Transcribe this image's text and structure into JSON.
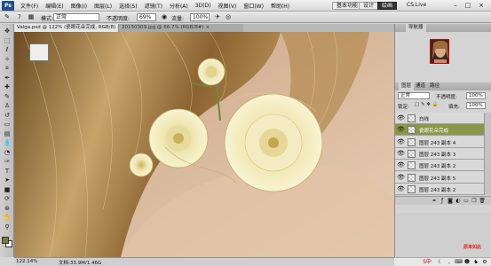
{
  "app": {
    "logo": "Ps",
    "menu": [
      "文件(F)",
      "编辑(E)",
      "图像(I)",
      "图层(L)",
      "选择(S)",
      "滤镜(T)",
      "分析(A)",
      "3D(D)",
      "视图(V)",
      "窗口(W)",
      "帮助(H)"
    ],
    "workspace_buttons": [
      "基本功能",
      "设计",
      "绘画"
    ],
    "active_workspace": "绘画",
    "cs_live": "CS Live",
    "window_controls": [
      "–",
      "□",
      "×"
    ]
  },
  "options": {
    "mode_label": "模式:",
    "mode_value": "正常",
    "opacity_label": "不透明度:",
    "opacity_value": "69%",
    "flow_label": "流量:",
    "flow_value": "100%",
    "brush_size": "7"
  },
  "documents": {
    "tabs": [
      {
        "label": "Valga.psd @ 122% (瓷眼花朵完成, RGB/8) ×",
        "active": true
      },
      {
        "label": "20150309.jpg @ 66.7% (RGB/8#) ×",
        "active": false
      }
    ]
  },
  "status": {
    "zoom": "122.14%",
    "doc_info": "文档:33.9M/1.46G"
  },
  "tools": {
    "icons": [
      "move-icon",
      "marquee-icon",
      "lasso-icon",
      "quick-select-icon",
      "crop-icon",
      "eyedropper-icon",
      "healing-icon",
      "brush-icon",
      "clone-stamp-icon",
      "history-brush-icon",
      "eraser-icon",
      "gradient-icon",
      "blur-icon",
      "dodge-icon",
      "pen-icon",
      "type-icon",
      "path-select-icon",
      "shape-icon",
      "3d-rotate-icon",
      "3d-orbit-icon",
      "hand-icon",
      "zoom-icon"
    ],
    "foreground_color": "#7a7d33",
    "background_color": "#ffffff"
  },
  "navigator": {
    "tab": "导航器"
  },
  "layers": {
    "tabs": [
      "图层",
      "通道",
      "路径"
    ],
    "blend_mode": "正常",
    "opacity_label": "不透明度:",
    "opacity_value": "100%",
    "lock_label": "锁定:",
    "fill_label": "填充:",
    "fill_value": "100%",
    "rows": [
      {
        "name": "白线",
        "selected": false
      },
      {
        "name": "瓷眼花朵完成",
        "selected": true
      },
      {
        "name": "图层 243 副本 4",
        "selected": false
      },
      {
        "name": "图层 243 副本 3",
        "selected": false
      },
      {
        "name": "图层 243 副本 2",
        "selected": false
      },
      {
        "name": "图层 243 副本 5",
        "selected": false
      },
      {
        "name": "图层 243 副本 2",
        "selected": false
      }
    ],
    "footer_icons": [
      "link-icon",
      "fx-icon",
      "mask-icon",
      "adjustment-icon",
      "group-icon",
      "new-layer-icon",
      "trash-icon"
    ]
  },
  "taskbar": {
    "tray_text": "S中",
    "watermark": "原来如此"
  },
  "colors": {
    "selected_layer": "#8a974a",
    "active_workspace_bg": "#333333"
  }
}
